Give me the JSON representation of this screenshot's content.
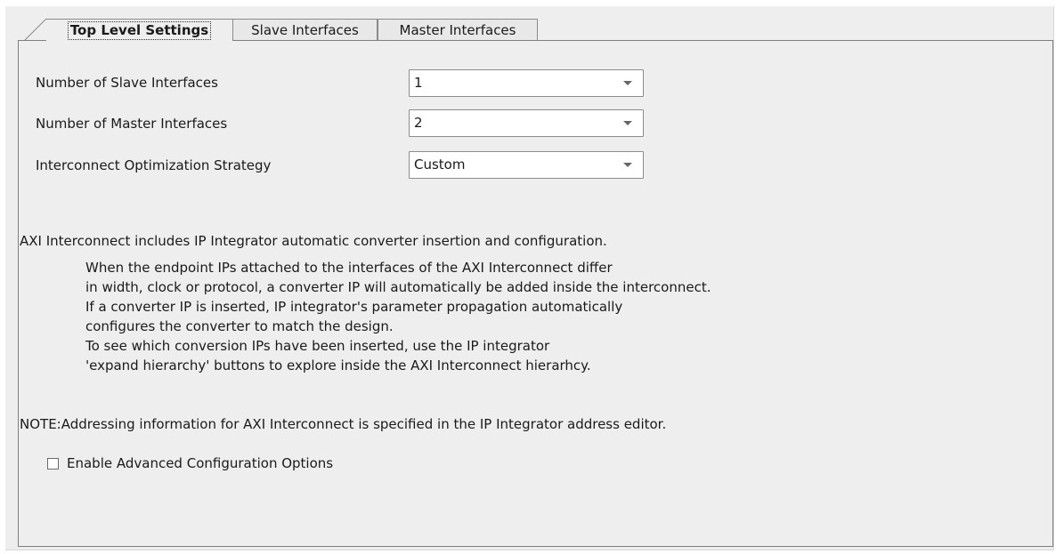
{
  "tabs": [
    {
      "label": "Top Level Settings",
      "active": true
    },
    {
      "label": "Slave Interfaces",
      "active": false
    },
    {
      "label": "Master Interfaces",
      "active": false
    }
  ],
  "settings": [
    {
      "label": "Number of Slave Interfaces",
      "value": "1"
    },
    {
      "label": "Number of Master Interfaces",
      "value": "2"
    },
    {
      "label": "Interconnect Optimization Strategy",
      "value": "Custom"
    }
  ],
  "info": {
    "heading": "AXI Interconnect includes IP Integrator automatic converter insertion and configuration.",
    "lines": [
      "When the endpoint IPs attached to the interfaces of the AXI Interconnect differ",
      "in width, clock or protocol, a converter IP will automatically be added inside the interconnect.",
      "If a converter IP is inserted, IP integrator's parameter propagation automatically",
      "configures the converter to match the design.",
      "To see which conversion IPs have been inserted, use the IP integrator",
      "'expand hierarchy' buttons to explore inside the AXI Interconnect hierarhcy."
    ],
    "note": "NOTE:Addressing information for AXI Interconnect is specified in the IP Integrator address editor."
  },
  "advanced": {
    "label": "Enable Advanced Configuration Options",
    "checked": false
  },
  "colors": {
    "background": "#eeeeee",
    "border": "#7f7f7f",
    "field": "#ffffff"
  },
  "icons": {
    "dropdown": "chevron-down-icon",
    "checkbox": "checkbox-icon"
  }
}
